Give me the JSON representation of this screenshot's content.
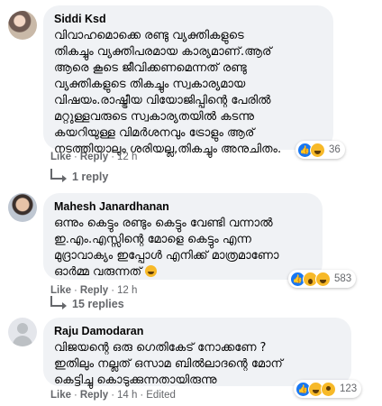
{
  "comments": [
    {
      "author": "Siddi Ksd",
      "text": "വിവാഹമൊക്കെ രണ്ടു വ്യക്തികളുടെ\nതികച്ചും വ്യക്തിപരമായ കാര്യമാണ്.ആര്\nആരെ കൂടെ ജീവിക്കണമെന്നത് രണ്ടു\nവ്യക്തികളുടെ തികച്ചും സ്വകാര്യമായ\nവിഷയം.രാഷ്ട്രീയ വിയോജിപ്പിന്റെ പേരിൽ\nമറ്റുള്ളവരുടെ സ്വകാര്യതയിൽ കടന്നു\nകയറിയുള്ള വിമർശനവും ട്രോളും ആര്\nനടത്തിയാലും ശരിയല്ല,തികച്ചും അനുചിതം.",
      "like": "Like",
      "reply": "Reply",
      "time": "12 h",
      "reaction_count": "36",
      "replies_label": "1 reply"
    },
    {
      "author": "Mahesh Janardhanan",
      "text": "ഒന്നും കെട്ടും രണ്ടും കെട്ടും വേണ്ടി വന്നാൽ\nഇ.എം.എസ്സിന്റെ മോളെ കെട്ടും എന്ന\nമുദ്രാവാക്യം ഇപ്പോൾ എനിക്ക് മാത്രമാണോ\nഓർമ്മ വരുന്നത്",
      "like": "Like",
      "reply": "Reply",
      "time": "12 h",
      "reaction_count": "583",
      "replies_label": "15 replies"
    },
    {
      "author": "Raju Damodaran",
      "text": "വിജയന്റെ ഒരു ഗെതികേട് നോക്കണേ ?\nഇതിലും നല്ലത് ഒസാമ ബിൽലാദന്റെ മോന്\nകെട്ടിച്ചു കൊടുക്കുന്നതായിരുന്നു",
      "like": "Like",
      "reply": "Reply",
      "time": "14 h",
      "edited": "Edited",
      "reaction_count": "123"
    }
  ],
  "icons": {
    "reaction_like": "thumbs-up",
    "reaction_haha": "laughing-face",
    "reaction_wow": "surprised-face",
    "reaction_sad": "sad-face",
    "reply_arrow": "reply-arrow",
    "inline_emoji": "laughing-emoji"
  },
  "colors": {
    "like_blue": "#1877f2",
    "emoji_yellow": "#f7b928",
    "bubble_bg": "#f0f2f5",
    "meta_gray": "#65676b"
  }
}
